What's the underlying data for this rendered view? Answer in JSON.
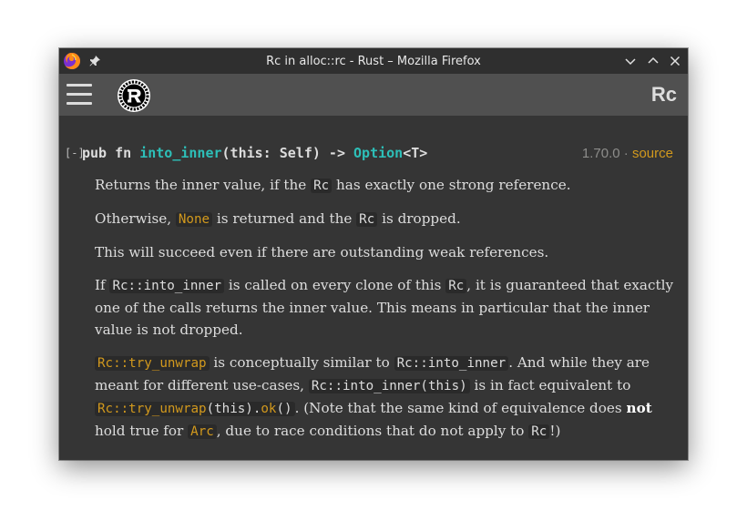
{
  "window": {
    "title": "Rc in alloc::rc - Rust – Mozilla Firefox"
  },
  "toolbar": {
    "crate_title": "Rc"
  },
  "signature": {
    "toggle": "[-]",
    "keywords": "pub fn ",
    "fn_name": "into_inner",
    "params": "(this: Self) -> ",
    "ret_type": "Option",
    "ret_generic": "<T>",
    "since": "1.70.0 · ",
    "source_link": "source"
  },
  "docs": {
    "p1": {
      "t1": "Returns the inner value, if the ",
      "c1": "Rc",
      "t2": " has exactly one strong reference."
    },
    "p2": {
      "c1": "None",
      "t1": " is returned and the ",
      "c2": "Rc",
      "t2": " is dropped.",
      "t0": "Otherwise, "
    },
    "p3": {
      "t1": "This will succeed even if there are outstanding weak references."
    },
    "p4": {
      "t0": "If ",
      "c1": "Rc::into_inner",
      "t1": " is called on every clone of this ",
      "c2": "Rc",
      "t2": ", it is guaranteed that exactly one of the calls returns the inner value. This means in particular that the inner value is not dropped."
    },
    "p5": {
      "c1": "Rc::try_unwrap",
      "t1": " is conceptually similar to ",
      "c2": "Rc::into_inner",
      "t2": ". And while they are meant for different use-cases, ",
      "c3": "Rc::into_inner(this)",
      "t3": " is in fact equivalent to ",
      "c4a": "Rc::try_unwrap",
      "c4b": "(this).",
      "c4c": "ok",
      "c4d": "()",
      "t4": ". (Note that the same kind of equivalence does ",
      "bold": "not",
      "t5": " hold true for ",
      "c5": "Arc",
      "t6": ", due to race conditions that do not apply to ",
      "c6": "Rc",
      "t7": "!)"
    }
  }
}
